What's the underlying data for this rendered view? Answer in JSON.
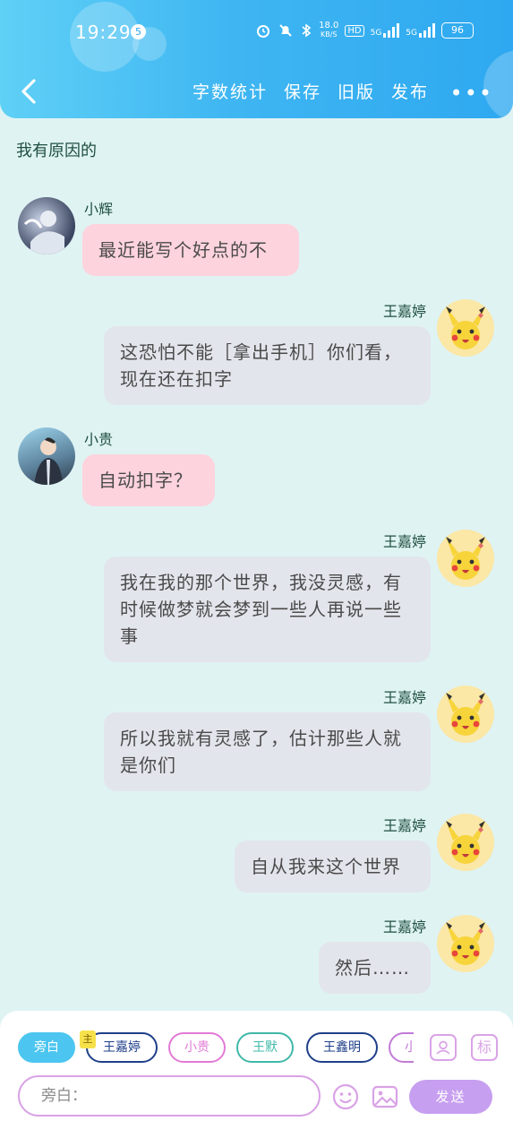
{
  "status_bar": {
    "time": "19:29",
    "notification_count": "5",
    "network_speed_value": "18.0",
    "network_speed_unit": "KB/S",
    "hd_label": "HD",
    "signal1_label": "5G",
    "signal2_label": "5G",
    "battery": "96"
  },
  "header": {
    "actions": [
      "字数统计",
      "保存",
      "旧版",
      "发布"
    ],
    "more": "•••"
  },
  "chat": {
    "narration": "我有原因的",
    "messages": [
      {
        "side": "left",
        "name": "小辉",
        "text": "最近能写个好点的不",
        "avatar": "boy-angel-avatar"
      },
      {
        "side": "right",
        "name": "王嘉婷",
        "text": "这恐怕不能［拿出手机］你们看，现在还在扣字",
        "avatar": "pikachu-avatar"
      },
      {
        "side": "left",
        "name": "小贵",
        "text": "自动扣字？",
        "avatar": "boy-jacket-avatar"
      },
      {
        "side": "right",
        "name": "王嘉婷",
        "text": "我在我的那个世界，我没灵感，有时候做梦就会梦到一些人再说一些事",
        "avatar": "pikachu-avatar"
      },
      {
        "side": "right",
        "name": "王嘉婷",
        "text": "所以我就有灵感了，估计那些人就是你们",
        "avatar": "pikachu-avatar"
      },
      {
        "side": "right",
        "name": "王嘉婷",
        "text": "自从我来这个世界",
        "avatar": "pikachu-avatar"
      },
      {
        "side": "right",
        "name": "王嘉婷",
        "text": "然后……",
        "avatar": "pikachu-avatar"
      }
    ]
  },
  "composer": {
    "roles": [
      {
        "label": "旁白",
        "color": "#4cc6f0",
        "selected": true
      },
      {
        "label": "王嘉婷",
        "color": "#1e3f8a",
        "selected": false
      },
      {
        "label": "小贵",
        "color": "#e27ad6",
        "selected": false
      },
      {
        "label": "王默",
        "color": "#3fb8a8",
        "selected": false
      },
      {
        "label": "王鑫明",
        "color": "#1e3f8a",
        "selected": false
      },
      {
        "label": "小辉",
        "color": "#c27ad6",
        "selected": false
      }
    ],
    "main_role_tag": "主",
    "tag_icon_label": "标",
    "input_placeholder": "旁白：",
    "send_label": "发送",
    "accent": "#c79ff0"
  }
}
